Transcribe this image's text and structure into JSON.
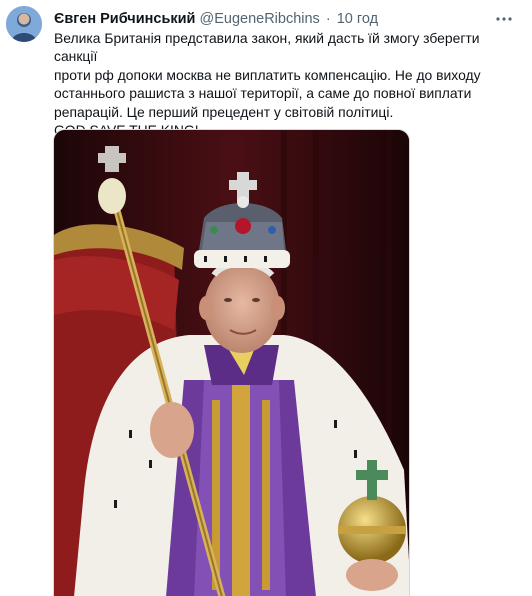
{
  "tweet": {
    "author_name": "Євген Рибчинський",
    "author_handle": "@EugeneRibchins",
    "separator": "·",
    "time": "10 год",
    "lines": [
      "Велика Британія представила закон, який дасть їй змогу зберегти санкції",
      "проти рф допоки москва не виплатить компенсацію. Не до виходу",
      "останнього рашиста з нашої території, а саме до повної виплати",
      "репарацій. Це перший прецедент у світовій політиці.",
      "GOD SAVE THE KING!"
    ],
    "more_icon": "more-horizontal-icon",
    "colors": {
      "text": "#0f1419",
      "secondary": "#536471",
      "media_border": "#cfd9de"
    }
  }
}
